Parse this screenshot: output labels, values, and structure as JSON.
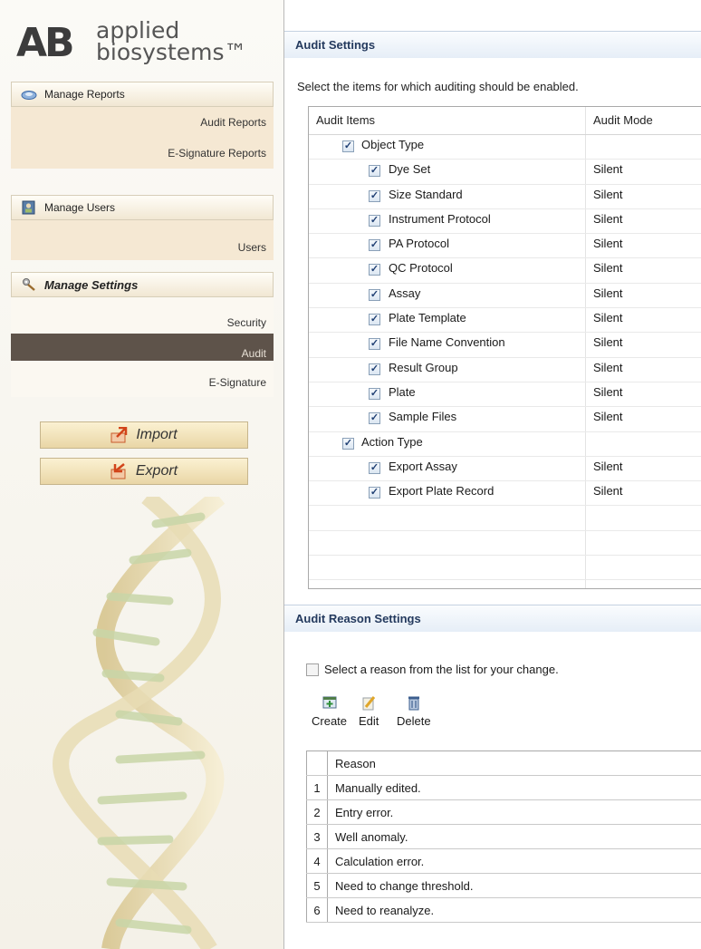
{
  "logo": {
    "mark": "AB",
    "line1": "applied",
    "line2": "biosystems™"
  },
  "sidebar": {
    "sections": [
      {
        "header": "Manage Reports",
        "icon": "reports-icon",
        "items": [
          "Audit Reports",
          "E-Signature Reports"
        ]
      },
      {
        "header": "Manage Users",
        "icon": "users-icon",
        "items": [
          "Users"
        ]
      },
      {
        "header": "Manage Settings",
        "icon": "settings-icon",
        "items": [
          "Security",
          "Audit",
          "E-Signature"
        ],
        "selected": "Audit"
      }
    ],
    "import_label": "Import",
    "export_label": "Export"
  },
  "audit": {
    "title": "Audit Settings",
    "instruction": "Select the items for which auditing should be enabled.",
    "col_items": "Audit Items",
    "col_mode": "Audit Mode",
    "rows": [
      {
        "label": "Object Type",
        "level": 0,
        "checked": true,
        "mode": ""
      },
      {
        "label": "Dye Set",
        "level": 1,
        "checked": true,
        "mode": "Silent"
      },
      {
        "label": "Size Standard",
        "level": 1,
        "checked": true,
        "mode": "Silent"
      },
      {
        "label": "Instrument Protocol",
        "level": 1,
        "checked": true,
        "mode": "Silent"
      },
      {
        "label": "PA Protocol",
        "level": 1,
        "checked": true,
        "mode": "Silent"
      },
      {
        "label": "QC Protocol",
        "level": 1,
        "checked": true,
        "mode": "Silent"
      },
      {
        "label": "Assay",
        "level": 1,
        "checked": true,
        "mode": "Silent"
      },
      {
        "label": "Plate Template",
        "level": 1,
        "checked": true,
        "mode": "Silent"
      },
      {
        "label": "File Name Convention",
        "level": 1,
        "checked": true,
        "mode": "Silent"
      },
      {
        "label": "Result Group",
        "level": 1,
        "checked": true,
        "mode": "Silent"
      },
      {
        "label": "Plate",
        "level": 1,
        "checked": true,
        "mode": "Silent"
      },
      {
        "label": "Sample Files",
        "level": 1,
        "checked": true,
        "mode": "Silent"
      },
      {
        "label": "Action Type",
        "level": 0,
        "checked": true,
        "mode": ""
      },
      {
        "label": "Export Assay",
        "level": 1,
        "checked": true,
        "mode": "Silent"
      },
      {
        "label": "Export Plate Record",
        "level": 1,
        "checked": true,
        "mode": "Silent"
      }
    ]
  },
  "reason": {
    "title": "Audit Reason Settings",
    "checkbox_label": "Select a reason from the list for your change.",
    "checkbox_checked": false,
    "buttons": {
      "create": "Create",
      "edit": "Edit",
      "delete": "Delete"
    },
    "col_reason": "Reason",
    "rows": [
      {
        "num": "1",
        "text": "Manually edited."
      },
      {
        "num": "2",
        "text": "Entry error."
      },
      {
        "num": "3",
        "text": "Well anomaly."
      },
      {
        "num": "4",
        "text": "Calculation error."
      },
      {
        "num": "5",
        "text": "Need to change threshold."
      },
      {
        "num": "6",
        "text": "Need to reanalyze."
      }
    ]
  },
  "colors": {
    "selected_nav": "#5e534a",
    "panel_title": "#243a5e",
    "check": "#1f3f73"
  }
}
